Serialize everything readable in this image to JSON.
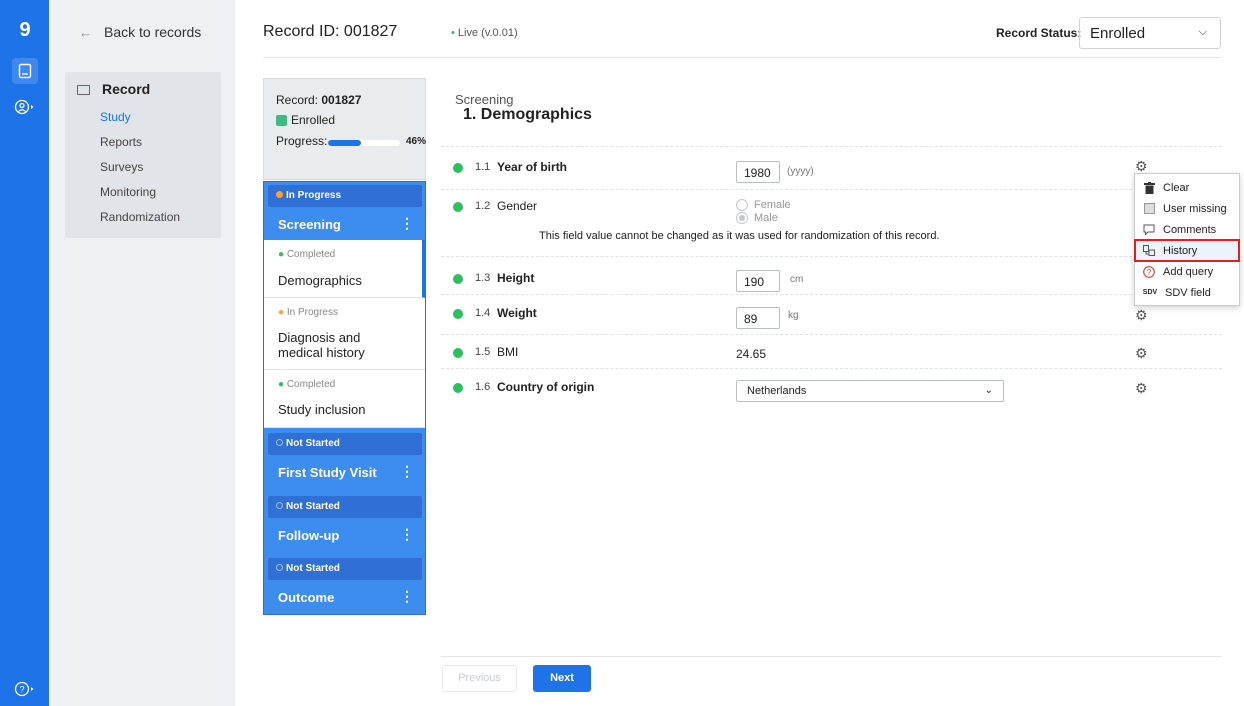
{
  "rail": {
    "logo": "9"
  },
  "subnav": {
    "back_label": "Back to records",
    "section_label": "Record",
    "items": [
      {
        "label": "Study",
        "current": true
      },
      {
        "label": "Reports"
      },
      {
        "label": "Surveys"
      },
      {
        "label": "Monitoring"
      },
      {
        "label": "Randomization"
      }
    ]
  },
  "header": {
    "record_id": "Record ID: 001827",
    "live": "Live (v.0.01)",
    "status_label": "Record Status:",
    "status_value": "Enrolled"
  },
  "record_card": {
    "record_prefix": "Record:",
    "record_number": "001827",
    "status": "Enrolled",
    "progress_label": "Progress:",
    "progress_percent": 46,
    "progress_text": "46%"
  },
  "phases": [
    {
      "status": "In Progress",
      "status_color": "#ff9f2e",
      "title": "Screening",
      "steps": [
        {
          "status": "Completed",
          "status_color": "#2cbf5e",
          "name": "Demographics",
          "selected": true
        },
        {
          "status": "In Progress",
          "status_color": "#ff9f2e",
          "name": "Diagnosis and medical history"
        },
        {
          "status": "Completed",
          "status_color": "#2cbf5e",
          "name": "Study inclusion"
        }
      ]
    },
    {
      "status": "Not Started",
      "title": "First Study Visit"
    },
    {
      "status": "Not Started",
      "title": "Follow-up"
    },
    {
      "status": "Not Started",
      "title": "Outcome"
    }
  ],
  "form": {
    "section": "Screening",
    "title": "1. Demographics",
    "fields": [
      {
        "num": "1.1",
        "label": "Year of birth",
        "value": "1980",
        "unit": "(yyyy)"
      },
      {
        "num": "1.2",
        "label": "Gender",
        "options": [
          "Female",
          "Male"
        ],
        "selected": "Male",
        "note": "This field value cannot be changed as it was used for randomization of this record."
      },
      {
        "num": "1.3",
        "label": "Height",
        "value": "190",
        "unit": "cm"
      },
      {
        "num": "1.4",
        "label": "Weight",
        "value": "89",
        "unit": "kg"
      },
      {
        "num": "1.5",
        "label": "BMI",
        "value": "24.65"
      },
      {
        "num": "1.6",
        "label": "Country of origin",
        "value": "Netherlands"
      }
    ]
  },
  "context_menu": {
    "items": [
      {
        "label": "Clear",
        "icon": "trash-icon"
      },
      {
        "label": "User missing",
        "icon": "checkbox-icon"
      },
      {
        "label": "Comments",
        "icon": "comment-icon"
      },
      {
        "label": "History",
        "icon": "history-icon",
        "highlighted": true
      },
      {
        "label": "Add query",
        "icon": "question-icon"
      },
      {
        "label": "SDV field",
        "icon": "sdv-icon",
        "icon_text": "SDV"
      }
    ]
  },
  "footer": {
    "previous": "Previous",
    "next": "Next"
  },
  "colors": {
    "accent": "#1f73e8",
    "complete": "#2cbf5e",
    "in_progress": "#ff9f2e",
    "highlight": "#e02020"
  }
}
